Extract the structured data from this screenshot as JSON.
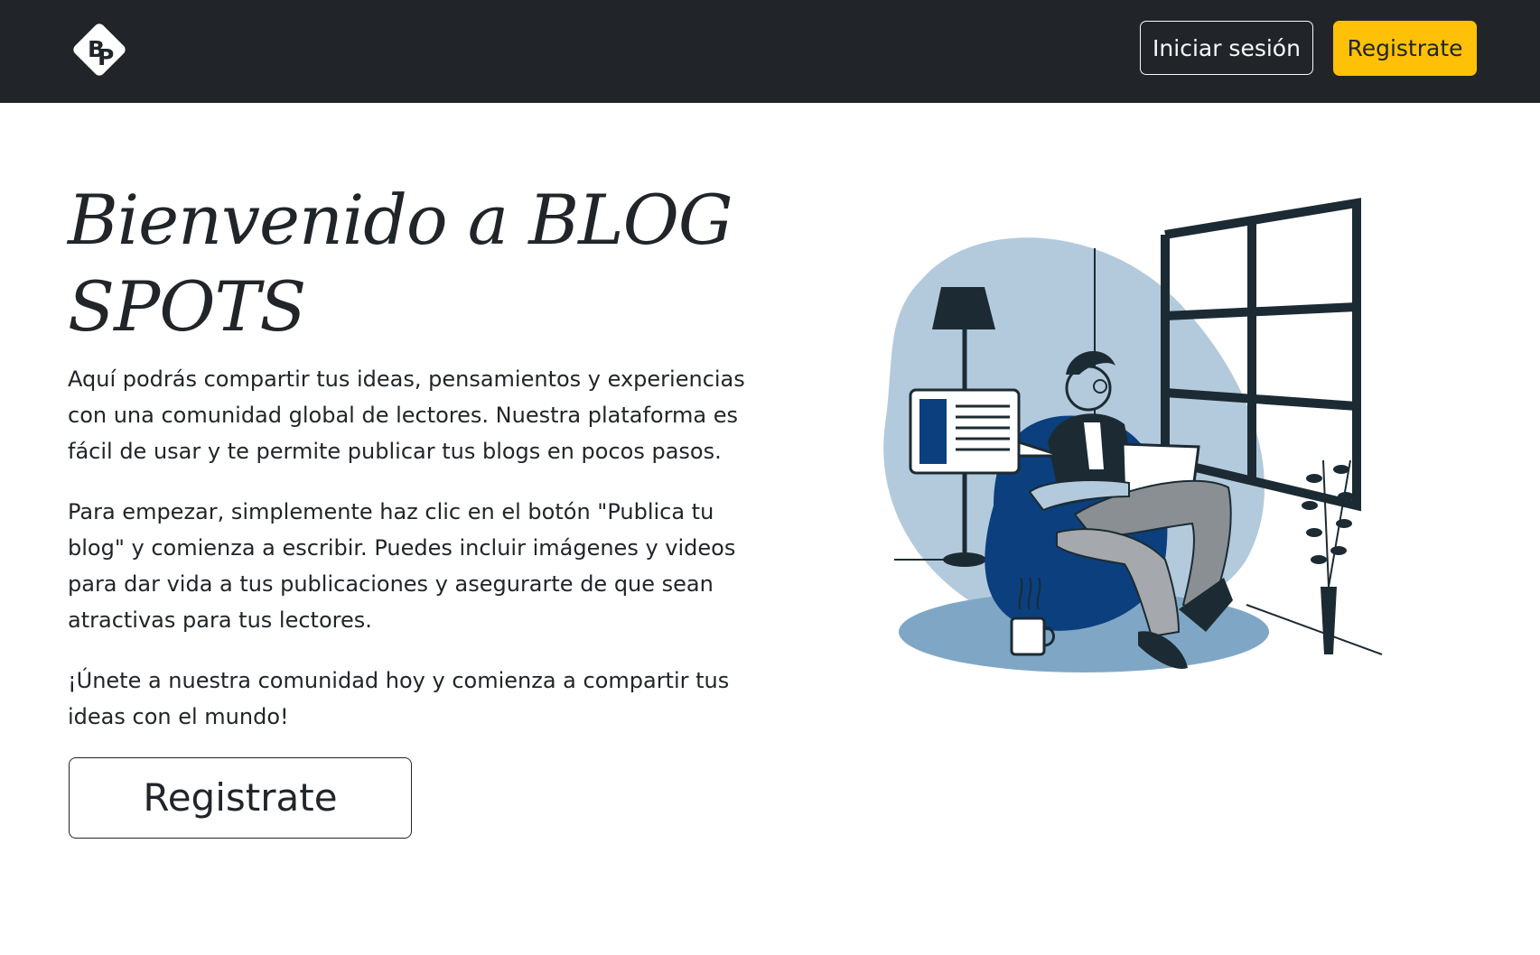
{
  "navbar": {
    "logo_text": "BP",
    "login_label": "Iniciar sesión",
    "register_label": "Registrate"
  },
  "hero": {
    "title": "Bienvenido a BLOG SPOTS",
    "paragraph_1": "Aquí podrás compartir tus ideas, pensamientos y experiencias con una comunidad global de lectores. Nuestra plataforma es fácil de usar y te permite publicar tus blogs en pocos pasos.",
    "paragraph_2": "Para empezar, simplemente haz clic en el botón \"Publica tu blog\" y comienza a escribir. Puedes incluir imágenes y videos para dar vida a tus publicaciones y asegurarte de que sean atractivas para tus lectores.",
    "paragraph_3": "¡Únete a nuestra comunidad hoy y comienza a compartir tus ideas con el mundo!",
    "register_button": "Registrate"
  },
  "colors": {
    "navbar_bg": "#212529",
    "accent_yellow": "#ffc107",
    "illustration_light_blue": "#b3cadd",
    "illustration_navy": "#0b3f7e",
    "illustration_dark": "#1c2b33"
  },
  "icons": {
    "logo": "bp-diamond-logo",
    "illustration": "man-reading-on-beanbag-illustration"
  }
}
